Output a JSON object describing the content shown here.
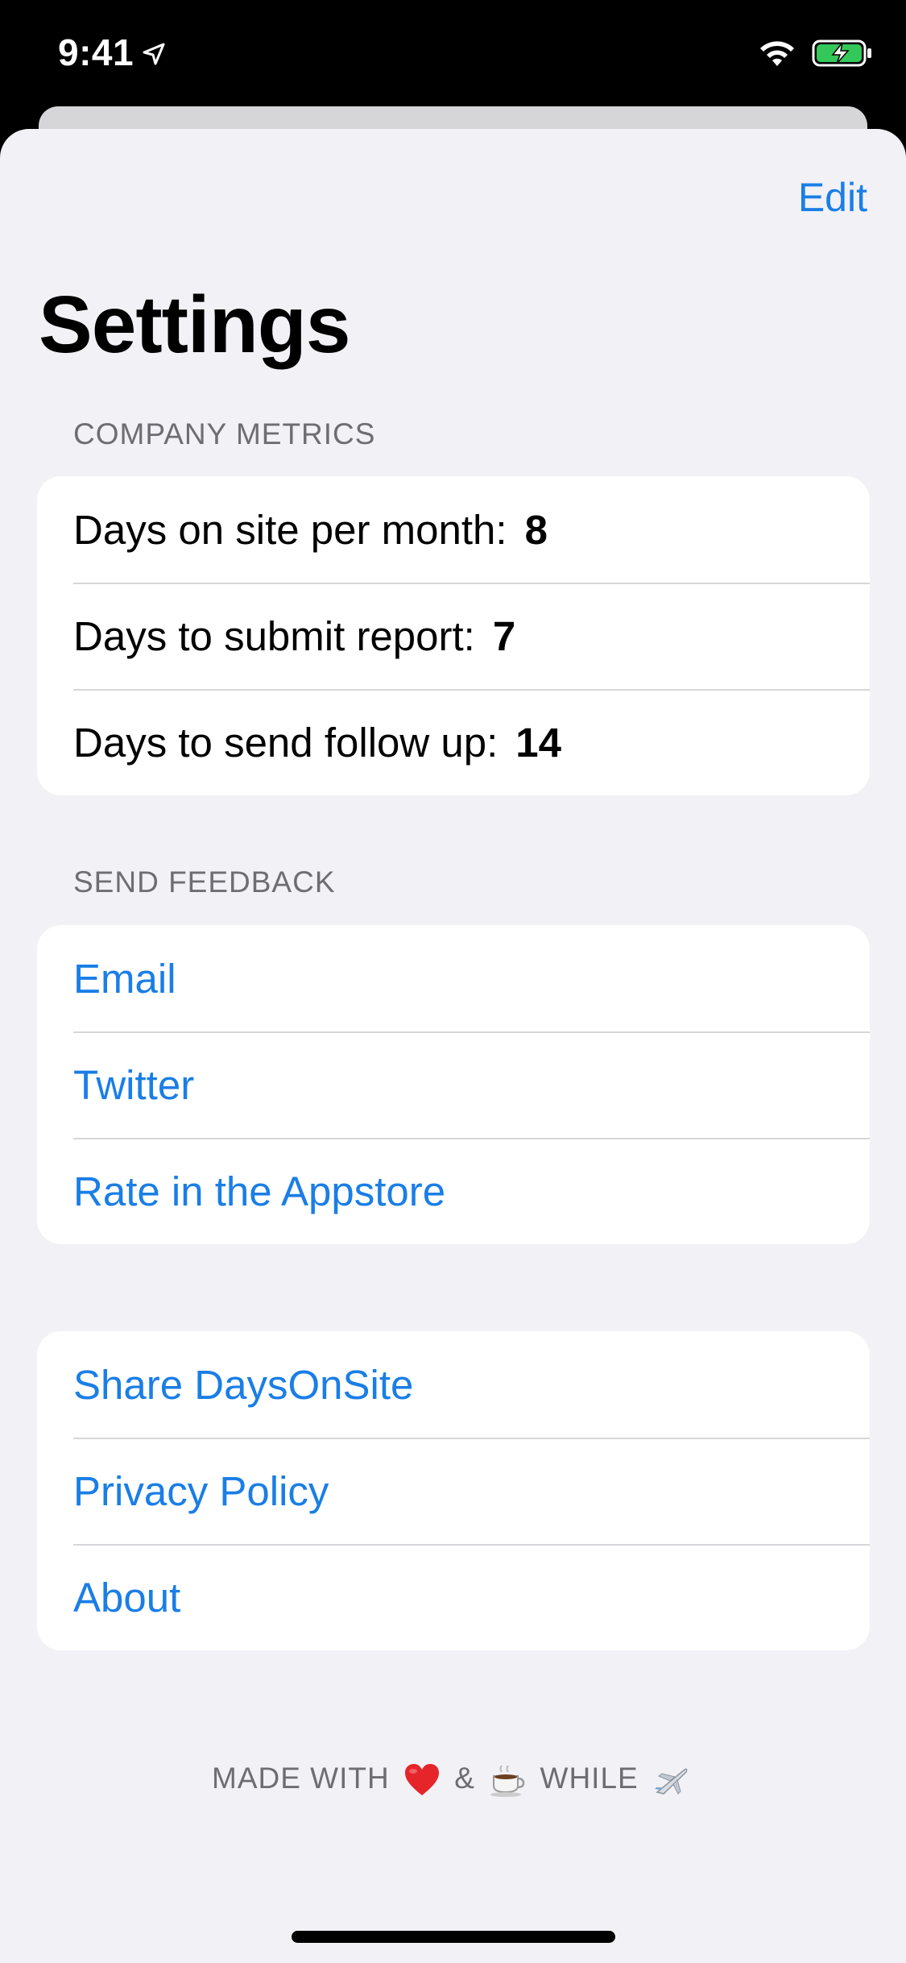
{
  "status_bar": {
    "time": "9:41"
  },
  "header": {
    "edit_label": "Edit",
    "title": "Settings"
  },
  "company_metrics": {
    "header": "COMPANY METRICS",
    "rows": [
      {
        "label": "Days on site per month:",
        "value": "8"
      },
      {
        "label": "Days to submit report:",
        "value": "7"
      },
      {
        "label": "Days to send follow up:",
        "value": "14"
      }
    ]
  },
  "send_feedback": {
    "header": "SEND FEEDBACK",
    "rows": [
      {
        "label": "Email"
      },
      {
        "label": "Twitter"
      },
      {
        "label": "Rate in the Appstore"
      }
    ]
  },
  "more": {
    "rows": [
      {
        "label": "Share DaysOnSite"
      },
      {
        "label": "Privacy Policy"
      },
      {
        "label": "About"
      }
    ]
  },
  "footer": {
    "made_with": "MADE WITH",
    "amp": "&",
    "while": "WHILE",
    "icons": [
      "heart-icon",
      "coffee-icon",
      "airplane-icon"
    ]
  },
  "colors": {
    "accent": "#1a7ee6",
    "background": "#f2f1f6",
    "secondary_text": "#6d6d72"
  }
}
